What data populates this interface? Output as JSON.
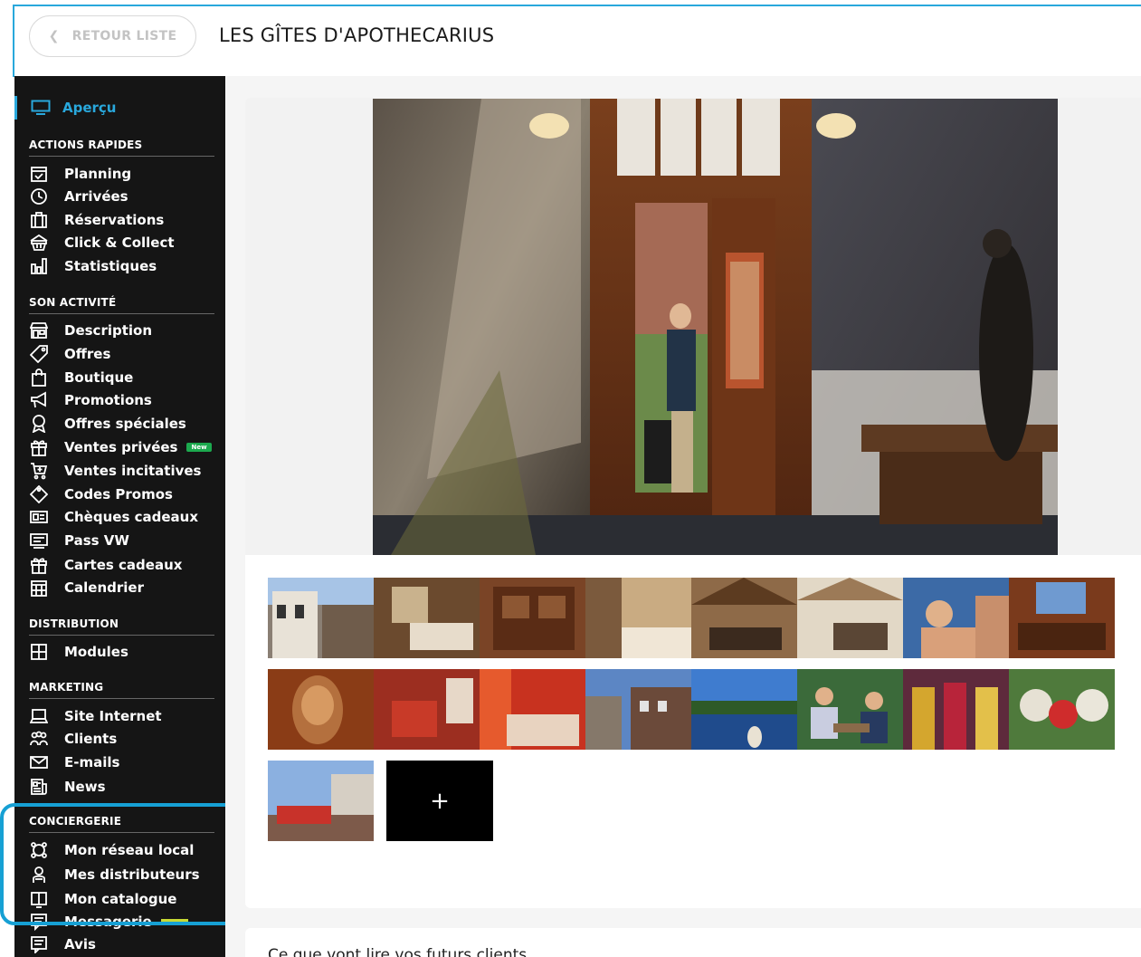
{
  "header": {
    "back_label": "RETOUR LISTE",
    "title": "LES GÎTES D'APOTHECARIUS"
  },
  "colors": {
    "accent": "#29a8dc",
    "sidebar_bg": "#151515",
    "new_badge": "#1ca94e",
    "highlight": "#16a0d4"
  },
  "sidebar": {
    "active": {
      "label": "Aperçu",
      "icon": "monitor-icon"
    },
    "sections": [
      {
        "title": "ACTIONS RAPIDES",
        "items": [
          {
            "label": "Planning",
            "icon": "calendar-check-icon"
          },
          {
            "label": "Arrivées",
            "icon": "clock-icon"
          },
          {
            "label": "Réservations",
            "icon": "briefcase-icon"
          },
          {
            "label": "Click & Collect",
            "icon": "basket-icon"
          },
          {
            "label": "Statistiques",
            "icon": "bar-chart-icon"
          }
        ]
      },
      {
        "title": "SON ACTIVITÉ",
        "items": [
          {
            "label": "Description",
            "icon": "storefront-icon"
          },
          {
            "label": "Offres",
            "icon": "tag-icon"
          },
          {
            "label": "Boutique",
            "icon": "shopping-bag-icon"
          },
          {
            "label": "Promotions",
            "icon": "megaphone-icon"
          },
          {
            "label": "Offres spéciales",
            "icon": "award-icon"
          },
          {
            "label": "Ventes privées",
            "icon": "gift-icon",
            "badge": "New"
          },
          {
            "label": "Ventes incitatives",
            "icon": "cart-plus-icon"
          },
          {
            "label": "Codes Promos",
            "icon": "diamond-tag-icon"
          },
          {
            "label": "Chèques cadeaux",
            "icon": "voucher-icon"
          },
          {
            "label": "Pass VW",
            "icon": "pass-card-icon"
          },
          {
            "label": "Cartes cadeaux",
            "icon": "gift-card-icon"
          },
          {
            "label": "Calendrier",
            "icon": "calendar-grid-icon"
          }
        ]
      },
      {
        "title": "DISTRIBUTION",
        "items": [
          {
            "label": "Modules",
            "icon": "grid-icon"
          }
        ]
      },
      {
        "title": "MARKETING",
        "items": [
          {
            "label": "Site Internet",
            "icon": "laptop-icon"
          },
          {
            "label": "Clients",
            "icon": "users-icon"
          },
          {
            "label": "E-mails",
            "icon": "envelope-icon"
          },
          {
            "label": "News",
            "icon": "newspaper-icon"
          }
        ]
      },
      {
        "title": "CONCIERGERIE",
        "items": [
          {
            "label": "Mon réseau local",
            "icon": "network-icon"
          },
          {
            "label": "Mes distributeurs",
            "icon": "distributor-icon"
          },
          {
            "label": "Mon catalogue",
            "icon": "book-icon"
          },
          {
            "label": "Messagerie",
            "icon": "message-icon"
          },
          {
            "label": "Avis",
            "icon": "review-icon"
          }
        ]
      }
    ]
  },
  "main": {
    "hero_alt": "",
    "add_photo_label": "+",
    "next_section_title": "Ce que vont lire vos futurs clients"
  }
}
